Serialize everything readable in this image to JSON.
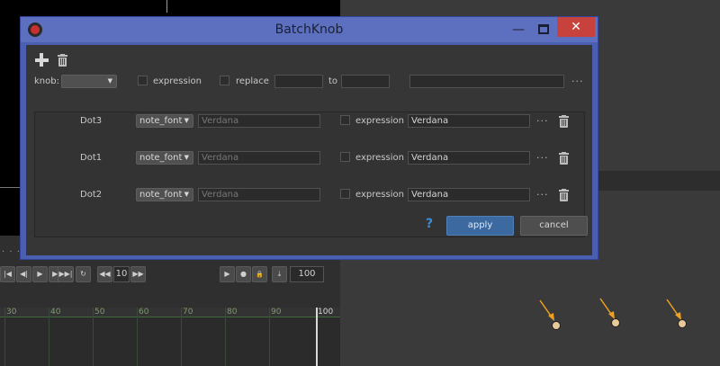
{
  "dialog": {
    "title": "BatchKnob",
    "minimize_glyph": "—",
    "close_glyph": "✕",
    "toolbar": {
      "add_icon": "plus-icon",
      "delete_icon": "trash-icon"
    },
    "header": {
      "knob_label": "knob:",
      "knob_value": "",
      "expression_label": "expression",
      "replace_label": "replace",
      "replace_from": "",
      "to_label": "to",
      "replace_to": "",
      "extra_field": "",
      "more": "···"
    },
    "rows": [
      {
        "node": "Dot3",
        "knob": "note_font",
        "current": "Verdana",
        "expression_label": "expression",
        "new_value": "Verdana",
        "more": "···"
      },
      {
        "node": "Dot1",
        "knob": "note_font",
        "current": "Verdana",
        "expression_label": "expression",
        "new_value": "Verdana",
        "more": "···"
      },
      {
        "node": "Dot2",
        "knob": "note_font",
        "current": "Verdana",
        "expression_label": "expression",
        "new_value": "Verdana",
        "more": "···"
      }
    ],
    "footer": {
      "help": "?",
      "apply": "apply",
      "cancel": "cancel"
    }
  },
  "transport": {
    "panel_menu": "· · ·",
    "increment": "10",
    "end_frame": "100",
    "buttons": [
      "|◀",
      "◀|",
      "▶",
      "▶|",
      "▶▶|",
      "↻",
      "◀◀",
      "▶▶",
      "▶",
      "●",
      "🔒",
      "⤓"
    ]
  },
  "timeline": {
    "ticks": [
      "30",
      "40",
      "50",
      "60",
      "70",
      "80",
      "90",
      "100"
    ]
  },
  "colors": {
    "dialog_frame": "#4a5fb0",
    "close_button": "#c8423d",
    "apply_button": "#3c6aa0",
    "node_arrow": "#f0a020"
  }
}
